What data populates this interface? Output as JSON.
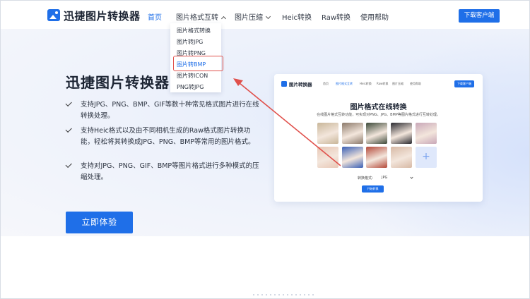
{
  "nav": {
    "brand": "迅捷图片转换器",
    "items": [
      "首页",
      "图片格式互转",
      "图片压缩",
      "Heic转换",
      "Raw转换",
      "使用帮助"
    ],
    "download_label": "下载客户端"
  },
  "dropdown": {
    "items": [
      "图片格式转换",
      "图片转JPG",
      "图片转PNG",
      "图片转BMP",
      "图片转ICON",
      "PNG转JPG"
    ],
    "highlighted": "图片转BMP"
  },
  "hero": {
    "title": "迅捷图片转换器",
    "features": [
      "支持JPG、PNG、BMP、GIF等数十种常见格式图片进行在线转换处理。",
      "支持Heic格式以及由不同相机生成的Raw格式图片转换功能，轻松将其转换成JPG、PNG、BMP等常用的图片格式。",
      "支持对JPG、PNG、GIF、BMP等图片格式进行多种模式的压缩处理。"
    ],
    "cta_label": "立即体验"
  },
  "preview": {
    "brand": "图片转换器",
    "nav": [
      "首页",
      "图片格式互转",
      "Heic转换",
      "Raw转换",
      "图片压缩",
      "使用帮助"
    ],
    "download_label": "下载客户端",
    "title": "图片格式在线转换",
    "subtitle": "在线图片格式互转功能，可实现对PNG、JPG、BMP等图片格式进行互转处理。",
    "format_label": "转换格式：",
    "format_value": "JPG",
    "start_label": "开始转换",
    "add_symbol": "+",
    "thumb_colors": [
      "#c9b79a",
      "#8c7a6b",
      "#3d4a3a",
      "#2a2a30",
      "#c9a8b8",
      "#e8c7b5",
      "#3a5fb5",
      "#b44a3a",
      "#d7b9a5"
    ]
  },
  "colors": {
    "accent": "#1f6fe8",
    "annotation": "#e0504b"
  }
}
